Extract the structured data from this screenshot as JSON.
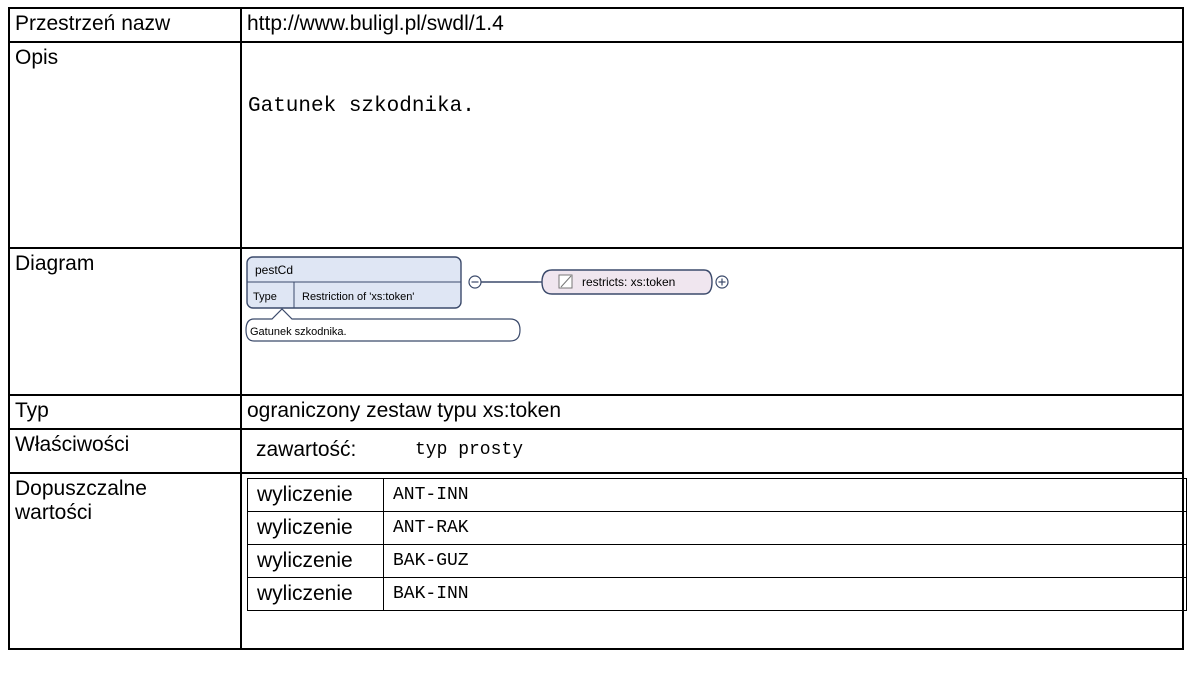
{
  "rows": {
    "namespace": {
      "label": "Przestrzeń nazw",
      "value": "http://www.buligl.pl/swdl/1.4"
    },
    "description": {
      "label": "Opis",
      "value": "Gatunek szkodnika."
    },
    "diagram": {
      "label": "Diagram",
      "element_name": "pestCd",
      "type_label": "Type",
      "type_value": "Restriction of 'xs:token'",
      "restricts": "restricts: xs:token",
      "annotation": "Gatunek szkodnika."
    },
    "type": {
      "label": "Typ",
      "value": "ograniczony zestaw typu xs:token"
    },
    "properties": {
      "label": "Właściwości",
      "key": "zawartość:",
      "value": "typ prosty"
    },
    "allowed": {
      "label_line1": "Dopuszczalne",
      "label_line2": "wartości",
      "items": [
        {
          "kind": "wyliczenie",
          "value": "ANT-INN"
        },
        {
          "kind": "wyliczenie",
          "value": "ANT-RAK"
        },
        {
          "kind": "wyliczenie",
          "value": "BAK-GUZ"
        },
        {
          "kind": "wyliczenie",
          "value": "BAK-INN"
        }
      ]
    }
  },
  "colors": {
    "box_fill": "#dfe6f4",
    "box_stroke": "#3b4a6b",
    "restricts_fill": "#f0e6ef"
  }
}
